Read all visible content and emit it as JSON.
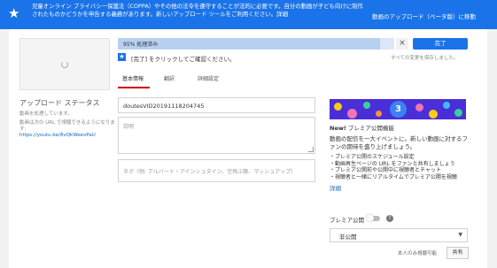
{
  "banner": {
    "message": "児童オンライン プライバシー保護法（COPPA）やその他の法令を遵守することが法的に必要です。自分の動画が子ども向けに制作されたものかどうかを申告する義務があります。新しいアップロード ツールをご利用ください。詳細",
    "beta_button": "動画のアップロード（ベータ版）に移動",
    "color": "#1a73e8"
  },
  "progress": {
    "label": "95% 処理済み",
    "fraction": 0.95,
    "done_button": "完了"
  },
  "notice": {
    "text": "[完了] をクリックしてご確認ください。",
    "saved": "すべての変更を保存しました。"
  },
  "tabs": [
    {
      "label": "基本情報",
      "active": true
    },
    {
      "label": "翻訳",
      "active": false
    },
    {
      "label": "詳細設定",
      "active": false
    }
  ],
  "upload_status": {
    "heading": "アップロード ステータス",
    "processing": "動画を処理しています。",
    "url_note": "動画は次の URL で視聴できるようになります:",
    "url": "https://youtu.be/8vQkWeevPaU"
  },
  "form": {
    "title_value": "doutesVID20191118204745",
    "description_placeholder": "説明",
    "tags_placeholder": "タグ（例: アルバート・アインシュタイン、空飛ぶ豚、マッシュアップ）"
  },
  "premiere": {
    "banner_number": "3",
    "title_new": "New!",
    "title_rest": " プレミア公開機能",
    "description": "動画の配信を一大イベントに。新しい動画に対するファンの期待を盛り上げましょう。",
    "bullets": [
      "・プレミア公開のスケジュール設定",
      "・動画再生ページの URL をファンと共有しましょう",
      "・プレミア公開前や公開中に視聴者とチャット",
      "・視聴者と一緒にリアルタイムでプレミア公開を視聴"
    ],
    "more_link": "詳細",
    "toggle_label": "プレミア公開",
    "help": "?",
    "visibility": "非公開",
    "caret": "▼",
    "only_me": "本人のみ視聴可能",
    "share_button": "共有"
  }
}
